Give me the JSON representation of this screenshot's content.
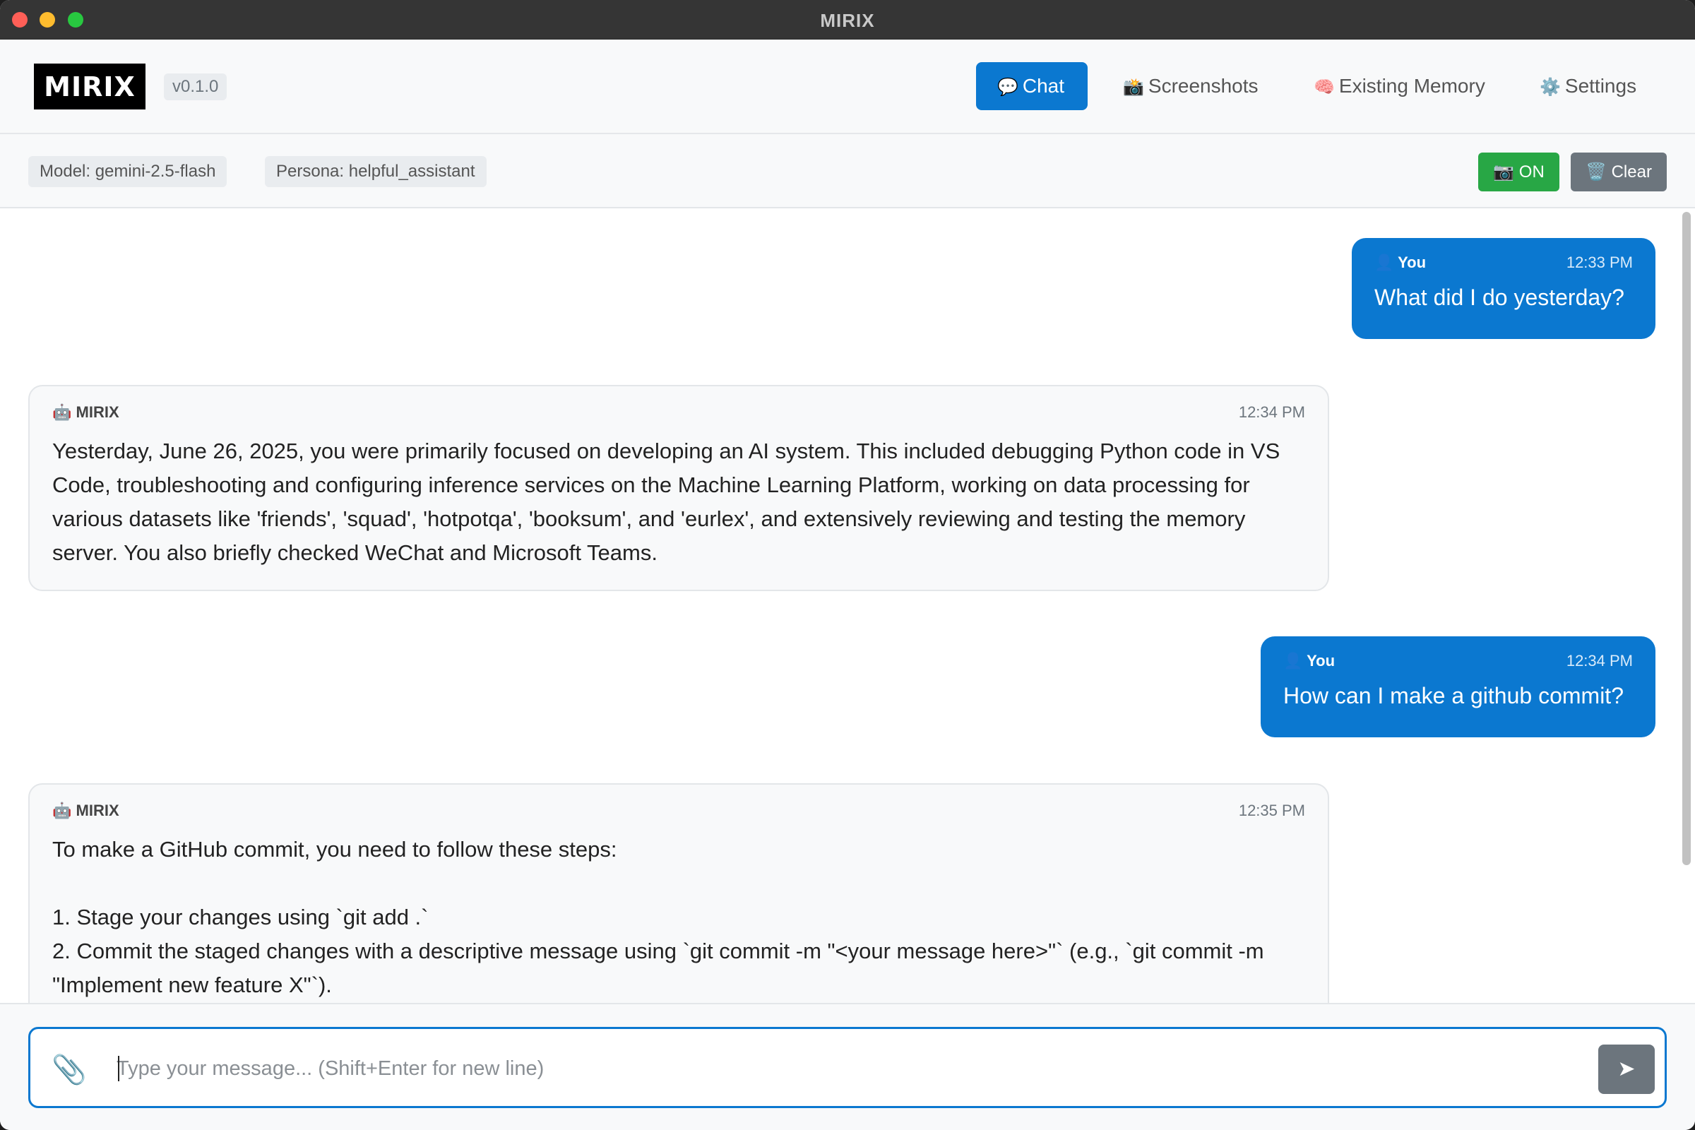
{
  "window": {
    "title": "MIRIX"
  },
  "header": {
    "logo_text": "MIRIX",
    "version": "v0.1.0",
    "tabs": [
      {
        "icon": "💬",
        "label": "Chat"
      },
      {
        "icon": "📸",
        "label": "Screenshots"
      },
      {
        "icon": "🧠",
        "label": "Existing Memory"
      },
      {
        "icon": "⚙️",
        "label": "Settings"
      }
    ]
  },
  "toolbar": {
    "model": "Model: gemini-2.5-flash",
    "persona": "Persona: helpful_assistant",
    "screenshot_toggle": {
      "icon": "📷",
      "label": "ON"
    },
    "clear_button": {
      "icon": "🗑️",
      "label": "Clear"
    }
  },
  "messages": [
    {
      "role": "user",
      "icon": "👤",
      "sender": "You",
      "time": "12:33 PM",
      "text": "What did I do yesterday?"
    },
    {
      "role": "assistant",
      "icon": "🤖",
      "sender": "MIRIX",
      "time": "12:34 PM",
      "text": "Yesterday, June 26, 2025, you were primarily focused on developing an AI system. This included debugging Python code in VS Code, troubleshooting and configuring inference services on the Machine Learning Platform, working on data processing for various datasets like 'friends', 'squad', 'hotpotqa', 'booksum', and 'eurlex', and extensively reviewing and testing the memory server. You also briefly checked WeChat and Microsoft Teams."
    },
    {
      "role": "user",
      "icon": "👤",
      "sender": "You",
      "time": "12:34 PM",
      "text": "How can I make a github commit?"
    },
    {
      "role": "assistant",
      "icon": "🤖",
      "sender": "MIRIX",
      "time": "12:35 PM",
      "intro": "To make a GitHub commit, you need to follow these steps:",
      "step1": "1. Stage your changes using `git add .`",
      "step2": "2. Commit the staged changes with a descriptive message using `git commit -m \"<your message here>\"` (e.g., `git commit -m \"Implement new feature X\"`)."
    }
  ],
  "input": {
    "placeholder": "Type your message... (Shift+Enter for new line)",
    "value": "",
    "attach_icon": "paperclip-icon",
    "send_icon": "send-arrow-icon"
  },
  "colors": {
    "accent": "#0b78d0",
    "on_green": "#28a745",
    "clear_gray": "#6c757d"
  }
}
